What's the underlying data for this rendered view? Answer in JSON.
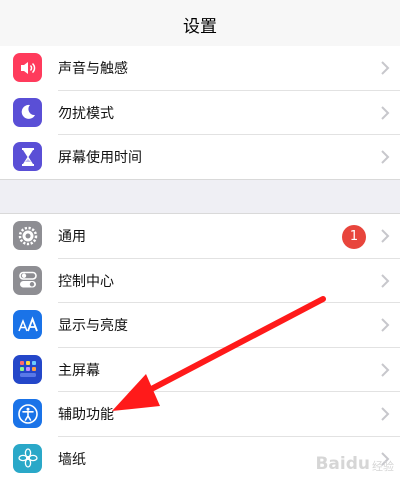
{
  "header": {
    "title": "设置"
  },
  "group1": {
    "items": [
      {
        "label": "声音与触感",
        "icon": "speaker-icon",
        "color": "#ff3b5c"
      },
      {
        "label": "勿扰模式",
        "icon": "moon-icon",
        "color": "#5a4fd6"
      },
      {
        "label": "屏幕使用时间",
        "icon": "hourglass-icon",
        "color": "#5a4fd6"
      }
    ]
  },
  "group2": {
    "items": [
      {
        "label": "通用",
        "icon": "gear-icon",
        "color": "#8e8e93",
        "badge": "1"
      },
      {
        "label": "控制中心",
        "icon": "toggles-icon",
        "color": "#8e8e93"
      },
      {
        "label": "显示与亮度",
        "icon": "text-size-icon",
        "color": "#1a73e8"
      },
      {
        "label": "主屏幕",
        "icon": "home-grid-icon",
        "color": "#2447c9"
      },
      {
        "label": "辅助功能",
        "icon": "accessibility-icon",
        "color": "#1a73e8"
      },
      {
        "label": "墙纸",
        "icon": "flower-icon",
        "color": "#2aa8c8"
      }
    ]
  },
  "watermark": {
    "brand": "Baidu",
    "text": "经验"
  },
  "colors": {
    "badge": "#e8453c",
    "arrow": "#ff1a1a",
    "chevron": "#c7c7cc"
  }
}
